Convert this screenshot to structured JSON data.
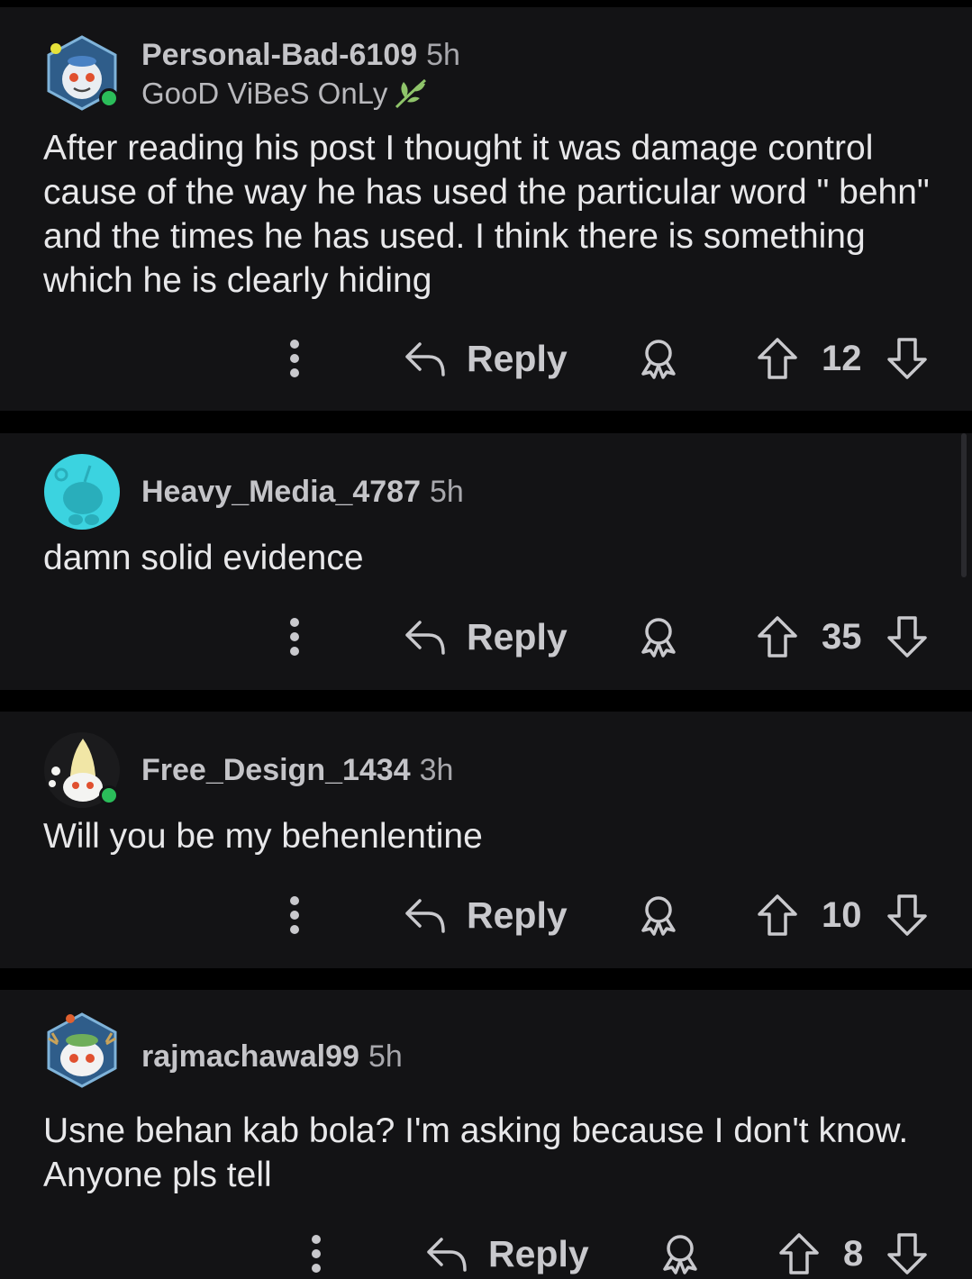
{
  "comments": [
    {
      "username": "Personal-Bad-6109",
      "time": "5h",
      "flair": "GooD ViBeS OnLy",
      "body": "After reading his post I thought it was damage control cause of the way he has used the particular word \" behn\" and the times he has used. I think there is something which he is clearly hiding",
      "reply_label": "Reply",
      "score": "12",
      "avatar_icon": "snoo-avatar-icon",
      "online": true
    },
    {
      "username": "Heavy_Media_4787",
      "time": "5h",
      "body": "damn solid evidence",
      "reply_label": "Reply",
      "score": "35",
      "avatar_icon": "default-snoo-avatar-icon",
      "online": false
    },
    {
      "username": "Free_Design_1434",
      "time": "3h",
      "body": "Will you be my behenlentine",
      "reply_label": "Reply",
      "score": "10",
      "avatar_icon": "snoo-avatar-icon",
      "online": true
    },
    {
      "username": "rajmachawal99",
      "time": "5h",
      "body": "Usne behan kab bola? I'm asking because I don't know. Anyone pls tell",
      "reply_label": "Reply",
      "score": "8",
      "avatar_icon": "snoo-avatar-icon",
      "online": false
    }
  ],
  "icons": {
    "more": "more-options-icon",
    "reply": "reply-arrow-icon",
    "award": "award-icon",
    "upvote": "upvote-arrow-icon",
    "downvote": "downvote-arrow-icon",
    "flair_emoji": "leaf-icon"
  },
  "colors": {
    "card_background": "#131315",
    "page_background": "#000000",
    "online_indicator": "#2bbd5a",
    "default_avatar": "#3bd3e0"
  }
}
